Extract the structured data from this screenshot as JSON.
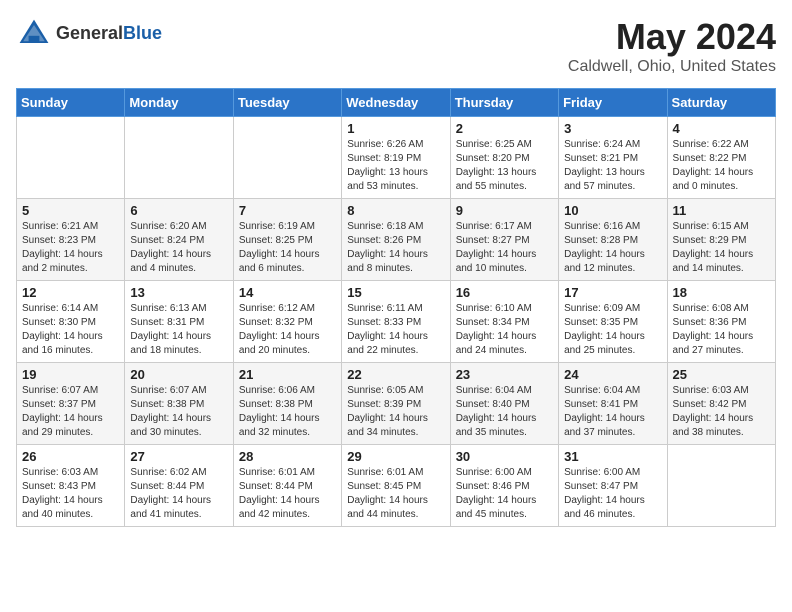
{
  "header": {
    "logo_general": "General",
    "logo_blue": "Blue",
    "month_title": "May 2024",
    "location": "Caldwell, Ohio, United States"
  },
  "weekdays": [
    "Sunday",
    "Monday",
    "Tuesday",
    "Wednesday",
    "Thursday",
    "Friday",
    "Saturday"
  ],
  "weeks": [
    [
      {
        "day": "",
        "sunrise": "",
        "sunset": "",
        "daylight": ""
      },
      {
        "day": "",
        "sunrise": "",
        "sunset": "",
        "daylight": ""
      },
      {
        "day": "",
        "sunrise": "",
        "sunset": "",
        "daylight": ""
      },
      {
        "day": "1",
        "sunrise": "Sunrise: 6:26 AM",
        "sunset": "Sunset: 8:19 PM",
        "daylight": "Daylight: 13 hours and 53 minutes."
      },
      {
        "day": "2",
        "sunrise": "Sunrise: 6:25 AM",
        "sunset": "Sunset: 8:20 PM",
        "daylight": "Daylight: 13 hours and 55 minutes."
      },
      {
        "day": "3",
        "sunrise": "Sunrise: 6:24 AM",
        "sunset": "Sunset: 8:21 PM",
        "daylight": "Daylight: 13 hours and 57 minutes."
      },
      {
        "day": "4",
        "sunrise": "Sunrise: 6:22 AM",
        "sunset": "Sunset: 8:22 PM",
        "daylight": "Daylight: 14 hours and 0 minutes."
      }
    ],
    [
      {
        "day": "5",
        "sunrise": "Sunrise: 6:21 AM",
        "sunset": "Sunset: 8:23 PM",
        "daylight": "Daylight: 14 hours and 2 minutes."
      },
      {
        "day": "6",
        "sunrise": "Sunrise: 6:20 AM",
        "sunset": "Sunset: 8:24 PM",
        "daylight": "Daylight: 14 hours and 4 minutes."
      },
      {
        "day": "7",
        "sunrise": "Sunrise: 6:19 AM",
        "sunset": "Sunset: 8:25 PM",
        "daylight": "Daylight: 14 hours and 6 minutes."
      },
      {
        "day": "8",
        "sunrise": "Sunrise: 6:18 AM",
        "sunset": "Sunset: 8:26 PM",
        "daylight": "Daylight: 14 hours and 8 minutes."
      },
      {
        "day": "9",
        "sunrise": "Sunrise: 6:17 AM",
        "sunset": "Sunset: 8:27 PM",
        "daylight": "Daylight: 14 hours and 10 minutes."
      },
      {
        "day": "10",
        "sunrise": "Sunrise: 6:16 AM",
        "sunset": "Sunset: 8:28 PM",
        "daylight": "Daylight: 14 hours and 12 minutes."
      },
      {
        "day": "11",
        "sunrise": "Sunrise: 6:15 AM",
        "sunset": "Sunset: 8:29 PM",
        "daylight": "Daylight: 14 hours and 14 minutes."
      }
    ],
    [
      {
        "day": "12",
        "sunrise": "Sunrise: 6:14 AM",
        "sunset": "Sunset: 8:30 PM",
        "daylight": "Daylight: 14 hours and 16 minutes."
      },
      {
        "day": "13",
        "sunrise": "Sunrise: 6:13 AM",
        "sunset": "Sunset: 8:31 PM",
        "daylight": "Daylight: 14 hours and 18 minutes."
      },
      {
        "day": "14",
        "sunrise": "Sunrise: 6:12 AM",
        "sunset": "Sunset: 8:32 PM",
        "daylight": "Daylight: 14 hours and 20 minutes."
      },
      {
        "day": "15",
        "sunrise": "Sunrise: 6:11 AM",
        "sunset": "Sunset: 8:33 PM",
        "daylight": "Daylight: 14 hours and 22 minutes."
      },
      {
        "day": "16",
        "sunrise": "Sunrise: 6:10 AM",
        "sunset": "Sunset: 8:34 PM",
        "daylight": "Daylight: 14 hours and 24 minutes."
      },
      {
        "day": "17",
        "sunrise": "Sunrise: 6:09 AM",
        "sunset": "Sunset: 8:35 PM",
        "daylight": "Daylight: 14 hours and 25 minutes."
      },
      {
        "day": "18",
        "sunrise": "Sunrise: 6:08 AM",
        "sunset": "Sunset: 8:36 PM",
        "daylight": "Daylight: 14 hours and 27 minutes."
      }
    ],
    [
      {
        "day": "19",
        "sunrise": "Sunrise: 6:07 AM",
        "sunset": "Sunset: 8:37 PM",
        "daylight": "Daylight: 14 hours and 29 minutes."
      },
      {
        "day": "20",
        "sunrise": "Sunrise: 6:07 AM",
        "sunset": "Sunset: 8:38 PM",
        "daylight": "Daylight: 14 hours and 30 minutes."
      },
      {
        "day": "21",
        "sunrise": "Sunrise: 6:06 AM",
        "sunset": "Sunset: 8:38 PM",
        "daylight": "Daylight: 14 hours and 32 minutes."
      },
      {
        "day": "22",
        "sunrise": "Sunrise: 6:05 AM",
        "sunset": "Sunset: 8:39 PM",
        "daylight": "Daylight: 14 hours and 34 minutes."
      },
      {
        "day": "23",
        "sunrise": "Sunrise: 6:04 AM",
        "sunset": "Sunset: 8:40 PM",
        "daylight": "Daylight: 14 hours and 35 minutes."
      },
      {
        "day": "24",
        "sunrise": "Sunrise: 6:04 AM",
        "sunset": "Sunset: 8:41 PM",
        "daylight": "Daylight: 14 hours and 37 minutes."
      },
      {
        "day": "25",
        "sunrise": "Sunrise: 6:03 AM",
        "sunset": "Sunset: 8:42 PM",
        "daylight": "Daylight: 14 hours and 38 minutes."
      }
    ],
    [
      {
        "day": "26",
        "sunrise": "Sunrise: 6:03 AM",
        "sunset": "Sunset: 8:43 PM",
        "daylight": "Daylight: 14 hours and 40 minutes."
      },
      {
        "day": "27",
        "sunrise": "Sunrise: 6:02 AM",
        "sunset": "Sunset: 8:44 PM",
        "daylight": "Daylight: 14 hours and 41 minutes."
      },
      {
        "day": "28",
        "sunrise": "Sunrise: 6:01 AM",
        "sunset": "Sunset: 8:44 PM",
        "daylight": "Daylight: 14 hours and 42 minutes."
      },
      {
        "day": "29",
        "sunrise": "Sunrise: 6:01 AM",
        "sunset": "Sunset: 8:45 PM",
        "daylight": "Daylight: 14 hours and 44 minutes."
      },
      {
        "day": "30",
        "sunrise": "Sunrise: 6:00 AM",
        "sunset": "Sunset: 8:46 PM",
        "daylight": "Daylight: 14 hours and 45 minutes."
      },
      {
        "day": "31",
        "sunrise": "Sunrise: 6:00 AM",
        "sunset": "Sunset: 8:47 PM",
        "daylight": "Daylight: 14 hours and 46 minutes."
      },
      {
        "day": "",
        "sunrise": "",
        "sunset": "",
        "daylight": ""
      }
    ]
  ]
}
